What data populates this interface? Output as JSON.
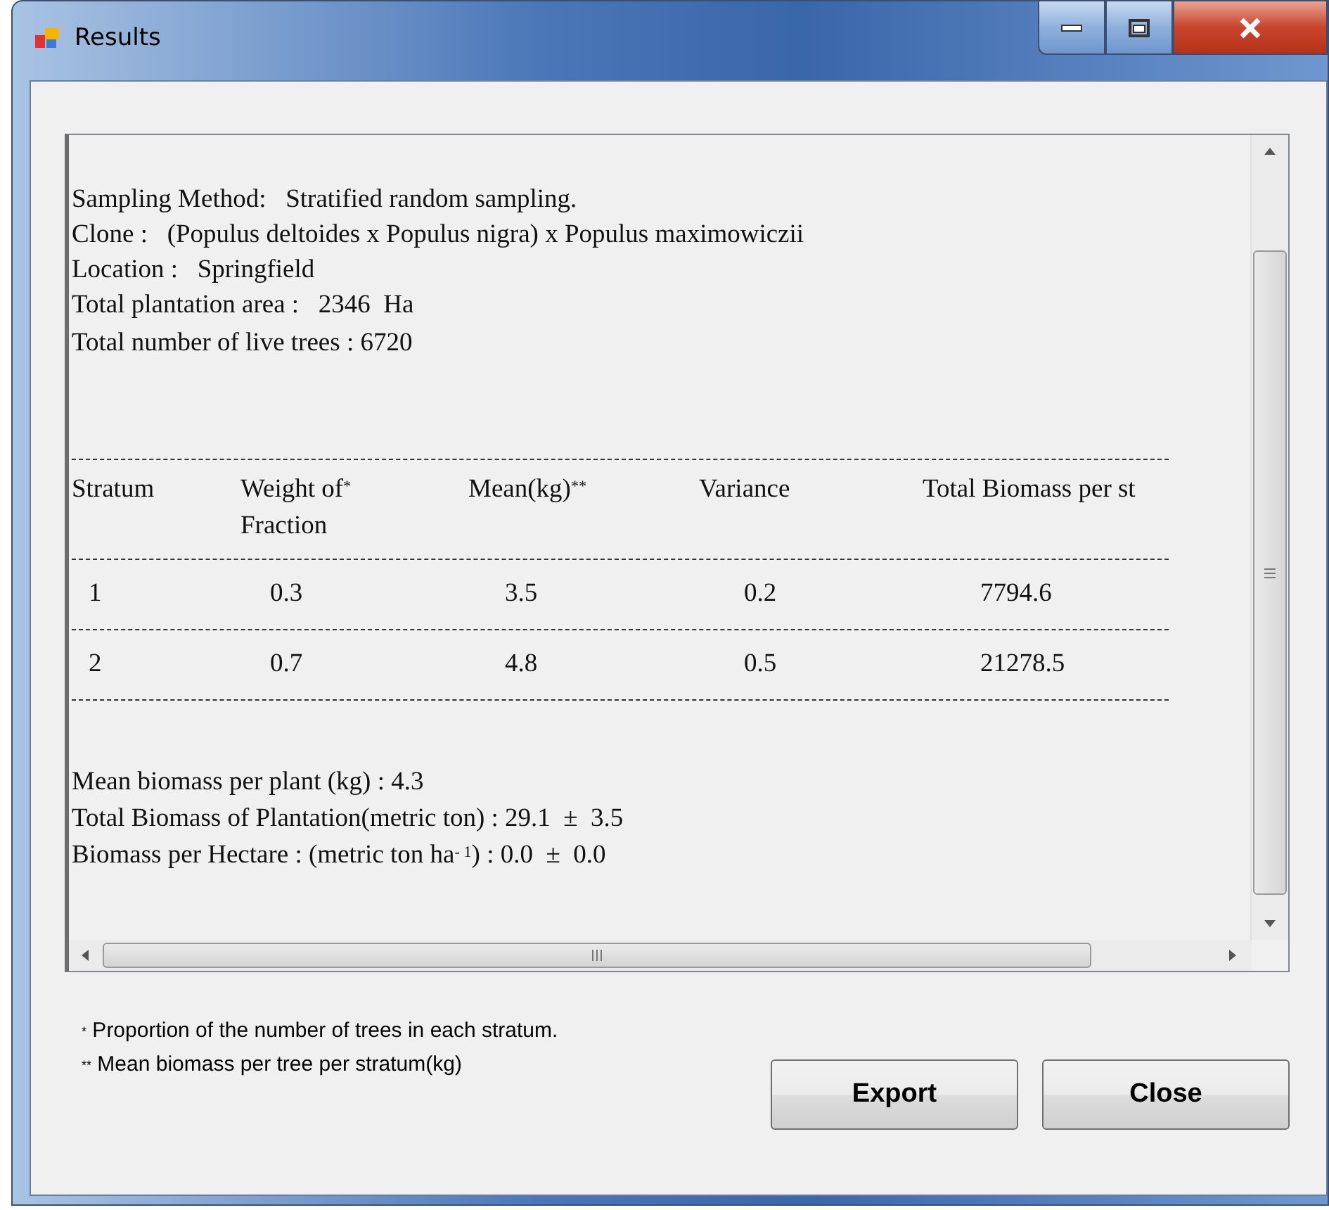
{
  "window": {
    "title": "Results"
  },
  "summary": [
    "Sampling Method:   Stratified random sampling.",
    "Clone :   (Populus deltoides x Populus nigra) x Populus maximowiczii",
    "Location :   Springfield",
    "Total plantation area :   2346  Ha",
    "Total number of live trees : 6720"
  ],
  "table": {
    "columns": [
      "Stratum",
      "Weight of$^{*}$ Fraction",
      "Mean(kg)$^{**}$",
      "Variance",
      "Total Biomass per st"
    ],
    "rows": [
      [
        "1",
        "0.3",
        "3.5",
        "0.2",
        "7794.6"
      ],
      [
        "2",
        "0.7",
        "4.8",
        "0.5",
        "21278.5"
      ]
    ]
  },
  "results": [
    "Mean biomass per plant (kg) : 4.3",
    "Total Biomass of Plantation(metric ton) : 29.1  ±  3.5",
    "Biomass per Hectare : (metric ton ha$^{- 1}$) : 0.0  ±  0.0"
  ],
  "footnotes": [
    "$^{*}$ Proportion of the number of trees in each stratum.",
    "$^{**}$ Mean biomass per tree per stratum(kg)"
  ],
  "buttons": [
    "Export",
    "Close"
  ]
}
